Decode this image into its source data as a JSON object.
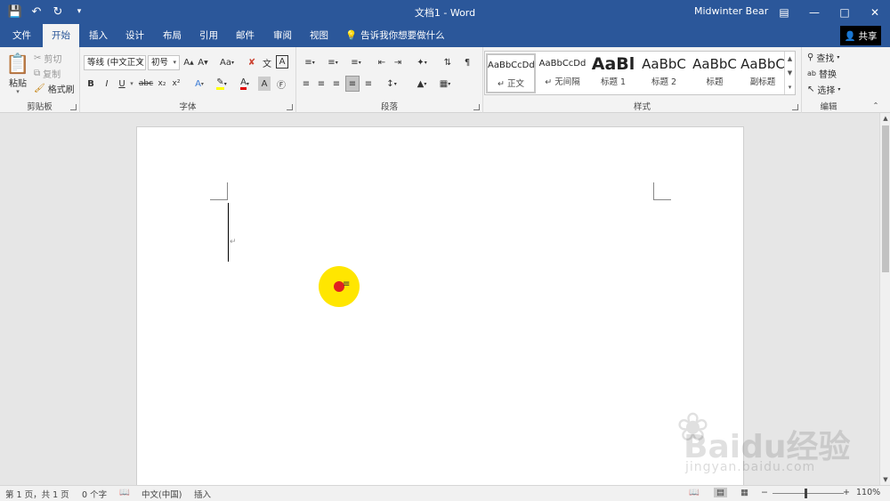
{
  "window": {
    "title": "文档1 - Word",
    "user": "Midwinter Bear",
    "accent": "#2b579a"
  },
  "qat": {
    "save_icon": "save-icon",
    "undo_icon": "undo-icon",
    "redo_icon": "redo-icon",
    "customize_icon": "customize-qat-icon"
  },
  "tabs": [
    {
      "label": "文件"
    },
    {
      "label": "开始",
      "active": true
    },
    {
      "label": "插入"
    },
    {
      "label": "设计"
    },
    {
      "label": "布局"
    },
    {
      "label": "引用"
    },
    {
      "label": "邮件"
    },
    {
      "label": "审阅"
    },
    {
      "label": "视图"
    }
  ],
  "tellme": "告诉我你想要做什么",
  "share": "共享",
  "ribbon": {
    "clipboard": {
      "label": "剪贴板",
      "paste": "粘贴",
      "cut": "剪切",
      "copy": "复制",
      "format_painter": "格式刷"
    },
    "font": {
      "label": "字体",
      "font_name": "等线 (中文正文",
      "font_size": "初号"
    },
    "paragraph": {
      "label": "段落"
    },
    "styles": {
      "label": "样式",
      "items": [
        {
          "preview": "AaBbCcDd",
          "name": "正文"
        },
        {
          "preview": "AaBbCcDd",
          "name": "无间隔"
        },
        {
          "preview": "AaBl",
          "name": "标题 1"
        },
        {
          "preview": "AaBbC",
          "name": "标题 2"
        },
        {
          "preview": "AaBbC",
          "name": "标题"
        },
        {
          "preview": "AaBbC",
          "name": "副标题"
        }
      ]
    },
    "editing": {
      "label": "编辑",
      "find": "查找",
      "replace": "替换",
      "select": "选择"
    }
  },
  "statusbar": {
    "page": "第 1 页，共 1 页",
    "words": "0 个字",
    "language": "中文(中国)",
    "mode": "插入",
    "zoom": "110%"
  },
  "watermark": {
    "brand": "Baidu经验",
    "url": "jingyan.baidu.com"
  }
}
